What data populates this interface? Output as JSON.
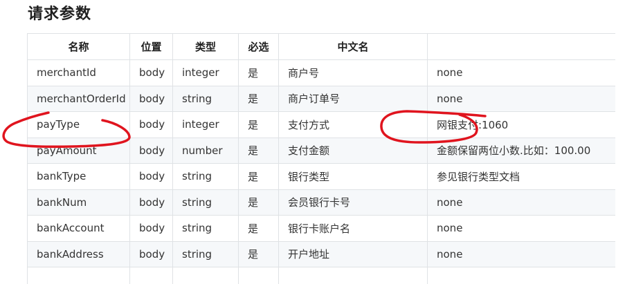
{
  "section": {
    "title": "请求参数"
  },
  "table": {
    "headers": [
      "名称",
      "位置",
      "类型",
      "必选",
      "中文名",
      ""
    ],
    "rows": [
      {
        "name": "merchantId",
        "in": "body",
        "type": "integer",
        "required": "是",
        "cn_name": "商户号",
        "desc": "none"
      },
      {
        "name": "merchantOrderId",
        "in": "body",
        "type": "string",
        "required": "是",
        "cn_name": "商户订单号",
        "desc": "none"
      },
      {
        "name": "payType",
        "in": "body",
        "type": "integer",
        "required": "是",
        "cn_name": "支付方式",
        "desc": "网银支付:1060"
      },
      {
        "name": "payAmount",
        "in": "body",
        "type": "number",
        "required": "是",
        "cn_name": "支付金额",
        "desc": "金额保留两位小数.比如：100.00"
      },
      {
        "name": "bankType",
        "in": "body",
        "type": "string",
        "required": "是",
        "cn_name": "银行类型",
        "desc": "参见银行类型文档"
      },
      {
        "name": "bankNum",
        "in": "body",
        "type": "string",
        "required": "是",
        "cn_name": "会员银行卡号",
        "desc": "none"
      },
      {
        "name": "bankAccount",
        "in": "body",
        "type": "string",
        "required": "是",
        "cn_name": "银行卡账户名",
        "desc": "none"
      },
      {
        "name": "bankAddress",
        "in": "body",
        "type": "string",
        "required": "是",
        "cn_name": "开户地址",
        "desc": "none"
      },
      {
        "name": "",
        "in": "",
        "type": "",
        "required": "",
        "cn_name": "",
        "desc": ""
      }
    ]
  },
  "annotation": {
    "stroke_color": "#e0141e"
  }
}
